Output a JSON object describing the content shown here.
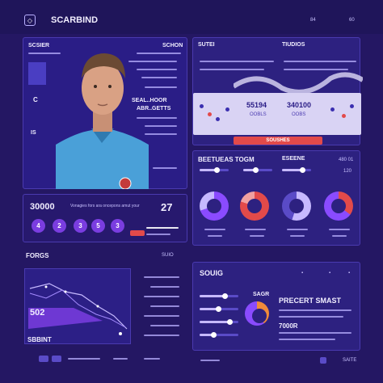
{
  "header": {
    "title": "SCARBIND",
    "right_a": "84",
    "right_b": "60"
  },
  "profile": {
    "label": "SCSIER",
    "code": "SCHON",
    "stat_title": "SEAL..HOOR",
    "stat_sub": "ABR..GETTS",
    "side_a": "C",
    "side_b": "IS"
  },
  "score": {
    "value": "30000",
    "text": "Vonagies fors ara oncepons amut your",
    "big": "27",
    "circles": [
      "4",
      "2",
      "3",
      "5",
      "3"
    ]
  },
  "forms": {
    "title": "FORGS",
    "tag": "SUIO",
    "value": "502",
    "footer": "SBBINT"
  },
  "top_right": {
    "title_a": "SUTEI",
    "title_b": "TIUDIOS",
    "val_a": "55194",
    "val_b": "340100",
    "sub_a": "OOBLS",
    "sub_b": "OOBS",
    "band": "SOUSHES"
  },
  "mid_right": {
    "title": "BEETUEAS TOGM",
    "label": "ESEENE",
    "v1": "480 01",
    "v2": "120"
  },
  "bottom_right": {
    "title": "SOUIG",
    "title_b": "SAGR",
    "headline": "PRECERT SMAST",
    "value": "7000R",
    "footer": "SAITE"
  },
  "colors": {
    "bg": "#241763",
    "panel": "#2d2180",
    "accent": "#8a4bff",
    "red": "#e24a4a"
  }
}
